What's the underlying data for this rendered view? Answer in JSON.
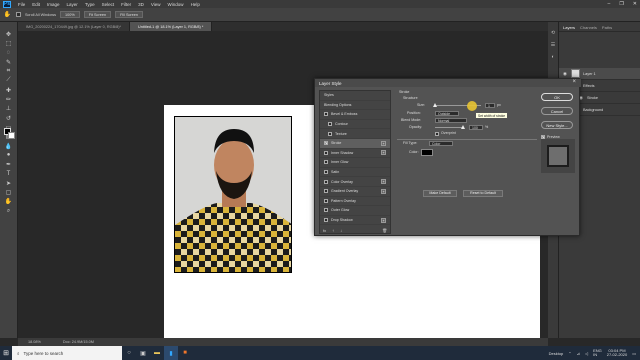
{
  "app": {
    "logo": "Ps"
  },
  "menubar": {
    "items": [
      "File",
      "Edit",
      "Image",
      "Layer",
      "Type",
      "Select",
      "Filter",
      "3D",
      "View",
      "Window",
      "Help"
    ]
  },
  "window_controls": [
    "–",
    "❐",
    "✕"
  ],
  "options_bar": {
    "scroll_all_windows": "Scroll All Windows",
    "zoom": "100%",
    "fit_screen": "Fit Screen",
    "fill_screen": "Fill Screen"
  },
  "tabs": [
    {
      "label": "IMG_20200224_170449.jpg @ 12.1% (Layer 0, RGB/8)*",
      "active": false
    },
    {
      "label": "Untitled-1 @ 18.1% (Layer 1, RGB/8) *",
      "active": true
    }
  ],
  "status": {
    "zoom": "18.08%",
    "doc": "Doc: 24.9M/15.0M"
  },
  "layers_panel": {
    "tabs": [
      "Layers",
      "Channels",
      "Paths"
    ],
    "layers": [
      {
        "name": "Layer 1",
        "selected": true
      },
      {
        "name": "Effects",
        "selected": false
      },
      {
        "name": "Stroke",
        "selected": false
      },
      {
        "name": "Background",
        "selected": false
      }
    ]
  },
  "dialog": {
    "title": "Layer Style",
    "styles": [
      {
        "label": "Styles",
        "check": false,
        "plus": false,
        "indent": false,
        "selected": false
      },
      {
        "label": "Blending Options",
        "check": false,
        "plus": false,
        "indent": false,
        "selected": false
      },
      {
        "label": "Bevel & Emboss",
        "check": true,
        "plus": false,
        "indent": false,
        "selected": false
      },
      {
        "label": "Contour",
        "check": true,
        "plus": false,
        "indent": true,
        "selected": false
      },
      {
        "label": "Texture",
        "check": true,
        "plus": false,
        "indent": true,
        "selected": false
      },
      {
        "label": "Stroke",
        "check": true,
        "checked": true,
        "plus": true,
        "indent": false,
        "selected": true
      },
      {
        "label": "Inner Shadow",
        "check": true,
        "plus": true,
        "indent": false,
        "selected": false
      },
      {
        "label": "Inner Glow",
        "check": true,
        "plus": false,
        "indent": false,
        "selected": false
      },
      {
        "label": "Satin",
        "check": true,
        "plus": false,
        "indent": false,
        "selected": false
      },
      {
        "label": "Color Overlay",
        "check": true,
        "plus": true,
        "indent": false,
        "selected": false
      },
      {
        "label": "Gradient Overlay",
        "check": true,
        "plus": true,
        "indent": false,
        "selected": false
      },
      {
        "label": "Pattern Overlay",
        "check": true,
        "plus": false,
        "indent": false,
        "selected": false
      },
      {
        "label": "Outer Glow",
        "check": true,
        "plus": false,
        "indent": false,
        "selected": false
      },
      {
        "label": "Drop Shadow",
        "check": true,
        "plus": true,
        "indent": false,
        "selected": false
      }
    ],
    "fx_label": "fx",
    "stroke": {
      "heading": "Stroke",
      "structure": "Structure",
      "size_label": "Size:",
      "size_value": "1",
      "size_unit": "px",
      "size_fraction": 0.02,
      "tooltip": "Set width of stroke",
      "position_label": "Position:",
      "position_value": "Outside",
      "blend_label": "Blend Mode:",
      "blend_value": "Normal",
      "opacity_label": "Opacity:",
      "opacity_value": "100",
      "opacity_unit": "%",
      "opacity_fraction": 1.0,
      "overprint": "Overprint",
      "fill_type_label": "Fill Type:",
      "fill_type_value": "Color",
      "color_label": "Color:",
      "make_default": "Make Default",
      "reset_default": "Reset to Default"
    },
    "buttons": {
      "ok": "OK",
      "cancel": "Cancel",
      "new_style": "New Style...",
      "preview": "Preview"
    }
  },
  "taskbar": {
    "search_placeholder": "Type here to search"
  },
  "tray": {
    "desktop": "Desktop",
    "lang": "ENG",
    "region": "IN",
    "time": "03:04 PM",
    "date": "27-02-2020"
  }
}
